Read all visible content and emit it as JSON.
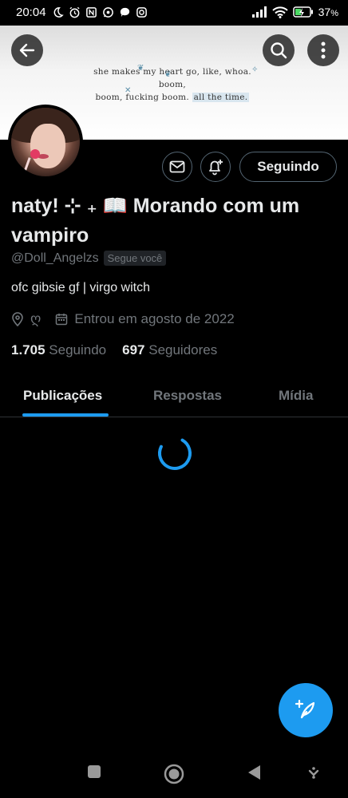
{
  "status_bar": {
    "time": "20:04",
    "battery": "37",
    "battery_unit": "%",
    "icons_left": [
      "moon-icon",
      "alarm-icon",
      "nfc-icon",
      "whatsapp-icon",
      "chat-bubble-icon",
      "instagram-icon"
    ],
    "icons_right": [
      "signal-icon",
      "wifi-icon",
      "battery-icon"
    ]
  },
  "banner": {
    "quote_line1": "she makes my heart go, like, whoa. boom,",
    "quote_line2": "boom, fucking boom.",
    "quote_highlight": "all the time.",
    "accent_color": "#d9e6ef"
  },
  "profile": {
    "display_name": "naty! ⊹ ₊ 📖 Morando com um vampiro",
    "handle": "@Doll_Angelzs",
    "follows_you": "Segue você",
    "bio": "ofc gibsie gf | virgo witch",
    "location": "ღ",
    "joined": "Entrou em agosto de 2022",
    "following_count": "1.705",
    "following_label": "Seguindo",
    "followers_count": "697",
    "followers_label": "Seguidores"
  },
  "actions": {
    "follow_button": "Seguindo"
  },
  "tabs": [
    {
      "label": "Publicações",
      "active": true
    },
    {
      "label": "Respostas",
      "active": false
    },
    {
      "label": "Mídia",
      "active": false
    }
  ],
  "colors": {
    "accent": "#1d9bf0",
    "background": "#000000",
    "secondary_text": "#71767b",
    "border": "#2f3336"
  }
}
